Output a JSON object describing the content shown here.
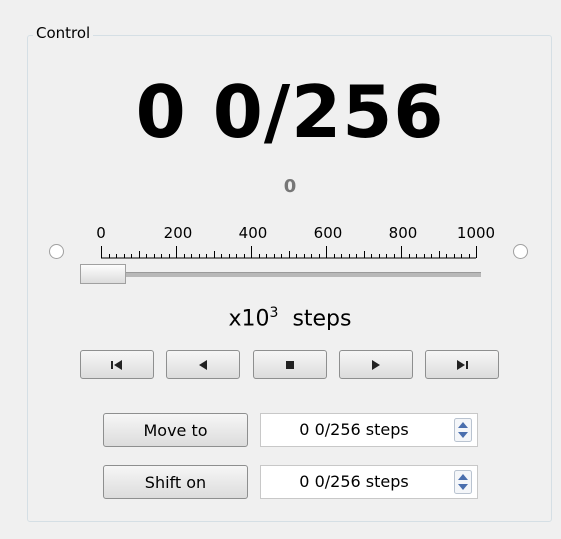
{
  "group": {
    "title": "Control"
  },
  "position": {
    "display": "0 0/256",
    "sub_value": "0"
  },
  "slider": {
    "scale_labels": [
      "0",
      "200",
      "400",
      "600",
      "800",
      "1000"
    ],
    "value": 0,
    "min": 0,
    "max": 1000
  },
  "units": {
    "prefix": "x10",
    "exponent": "3",
    "suffix": "steps"
  },
  "navigation": {
    "buttons": [
      {
        "name": "go-to-start",
        "icon": "skip-to-start-icon"
      },
      {
        "name": "step-back",
        "icon": "play-reverse-icon"
      },
      {
        "name": "stop",
        "icon": "stop-icon"
      },
      {
        "name": "step-forward",
        "icon": "play-icon"
      },
      {
        "name": "go-to-end",
        "icon": "skip-to-end-icon"
      }
    ]
  },
  "move_to": {
    "label": "Move to",
    "value": "0 0/256 steps"
  },
  "shift_on": {
    "label": "Shift on",
    "value": "0 0/256 steps"
  },
  "colors": {
    "background": "#f0f0f0",
    "subtext": "#777777",
    "spin_arrow": "#4a6fae"
  }
}
